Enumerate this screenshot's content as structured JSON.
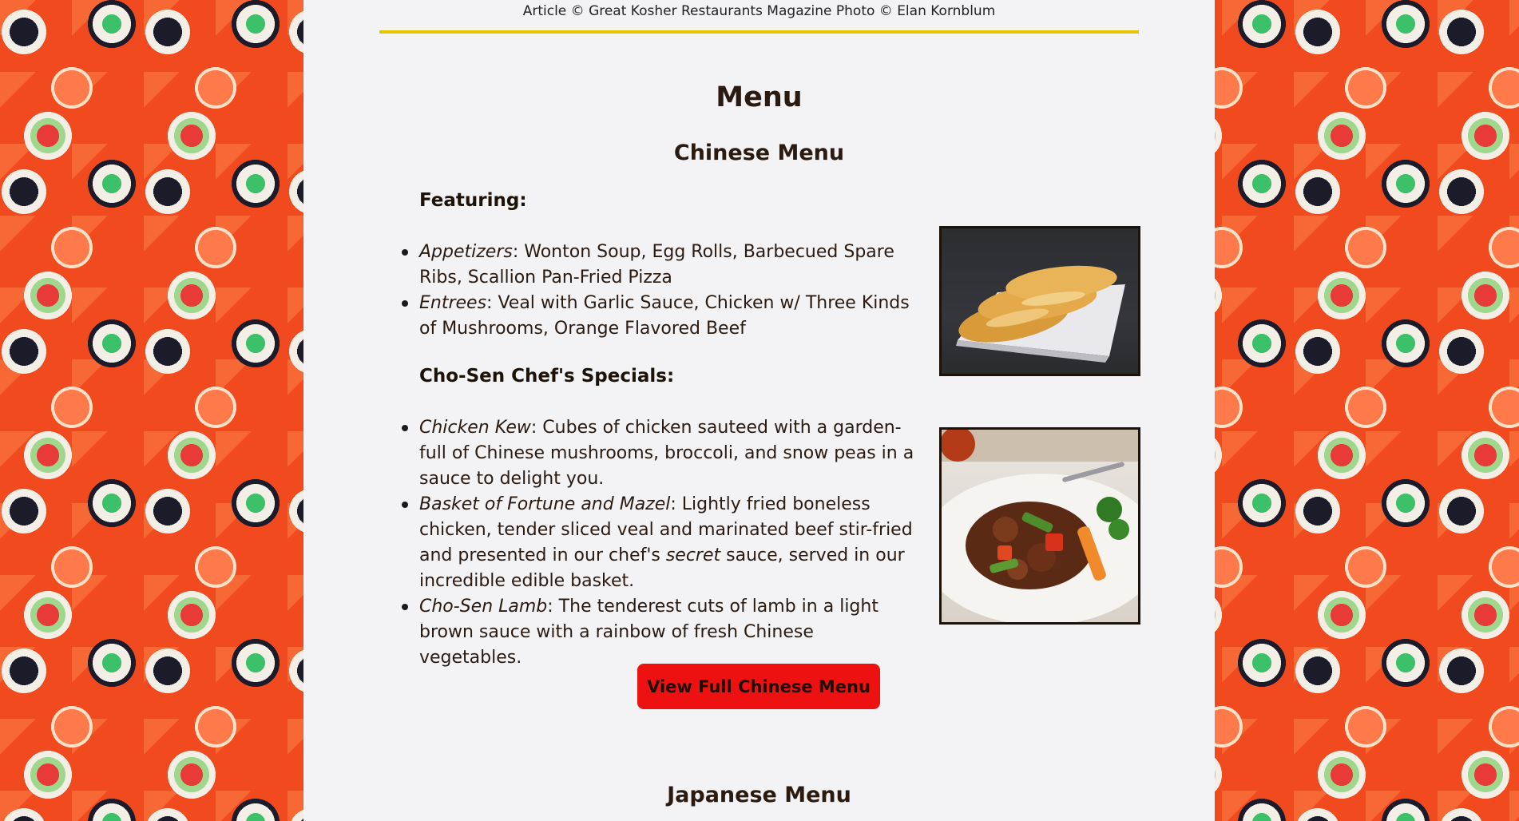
{
  "credit": "Article © Great Kosher Restaurants Magazine Photo © Elan Kornblum",
  "menu_title": "Menu",
  "chinese": {
    "title": "Chinese Menu",
    "featuring_heading": "Featuring:",
    "featuring": [
      {
        "name": "Appetizers",
        "desc": ": Wonton Soup, Egg Rolls, Barbecued Spare Ribs, Scallion Pan-Fried Pizza"
      },
      {
        "name": "Entrees",
        "desc": ": Veal with Garlic Sauce, Chicken w/ Three Kinds of Mushrooms, Orange Flavored Beef"
      }
    ],
    "specials_heading": "Cho-Sen Chef's Specials:",
    "specials": [
      {
        "name": "Chicken Kew",
        "desc": ": Cubes of chicken sauteed with a garden-full of Chinese mushrooms, broccoli, and snow peas in a sauce to delight you."
      },
      {
        "name": "Basket of Fortune and Mazel",
        "desc_before": ": Lightly fried boneless chicken, tender sliced veal and marinated beef stir-fried and presented in our chef's ",
        "emphasis": "secret",
        "desc_after": " sauce, served in our incredible edible basket."
      },
      {
        "name": "Cho-Sen Lamb",
        "desc": ": The tenderest cuts of lamb in a light brown sauce with a rainbow of fresh Chinese vegetables."
      }
    ],
    "button_label": "View Full Chinese Menu"
  },
  "japanese": {
    "title": "Japanese Menu"
  },
  "colors": {
    "accent_rule": "#e5c400",
    "button_bg": "#ee1111",
    "column_bg": "#f3f2f4",
    "background": "#f04a1e"
  }
}
